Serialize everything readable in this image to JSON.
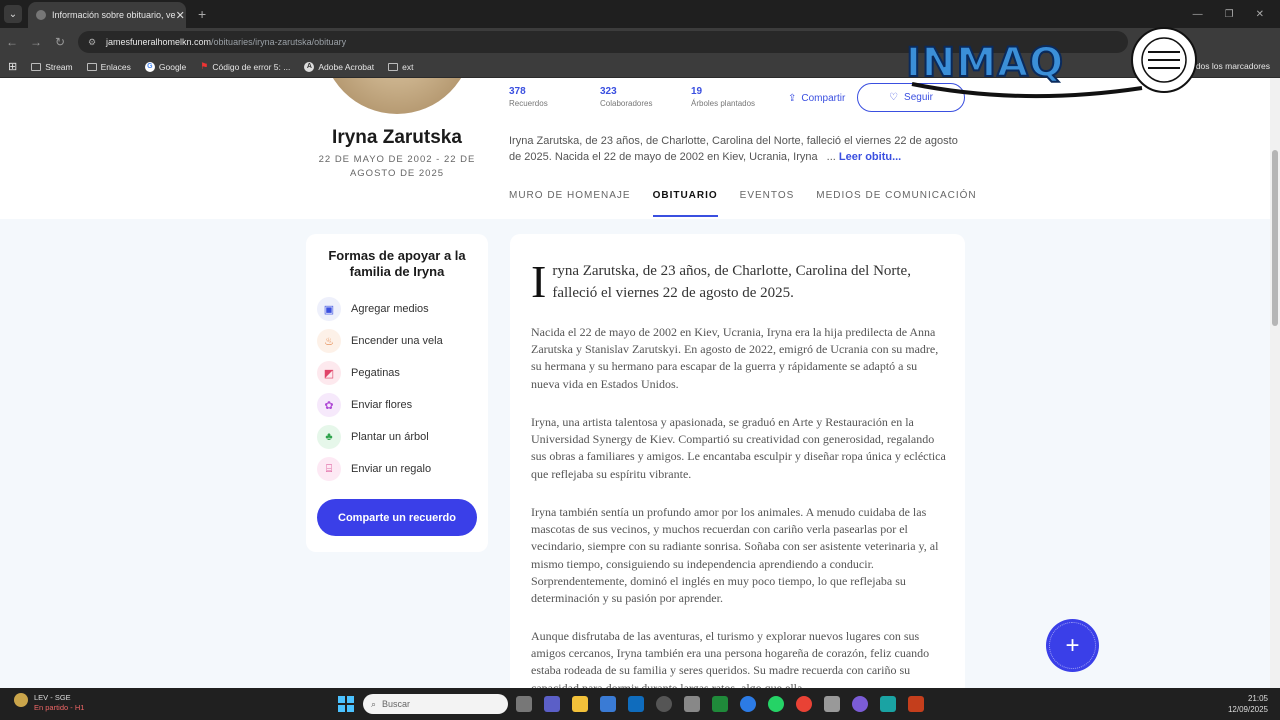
{
  "browser": {
    "tab_title": "Información sobre obituario, ve",
    "tab_close": "✕",
    "new_tab": "+",
    "url_host": "jamesfuneralhomelkn.com",
    "url_path": "/obituaries/iryna-zarutska/obituary",
    "bookmarks": [
      "Stream",
      "Enlaces",
      "Google",
      "Código de error 5: ...",
      "Adobe Acrobat",
      "ext"
    ],
    "bookmarks_right": "dos los marcadores"
  },
  "overlay_logo": "INMAQ",
  "profile": {
    "name": "Iryna Zarutska",
    "dates": "22 DE MAYO DE 2002 - 22 DE AGOSTO DE 2025",
    "stats": [
      {
        "value": "378",
        "label": "Recuerdos"
      },
      {
        "value": "323",
        "label": "Colaboradores"
      },
      {
        "value": "19",
        "label": "Árboles plantados"
      }
    ],
    "share_label": "Compartir",
    "follow_label": "Seguir",
    "intro": "Iryna Zarutska, de 23 años, de Charlotte, Carolina del Norte, falleció el viernes 22 de agosto de 2025. Nacida el 22 de mayo de 2002 en Kiev, Ucrania, Iryna",
    "intro_ellipsis": "...",
    "read_more": "Leer obitu..."
  },
  "tabs": [
    "MURO DE HOMENAJE",
    "OBITUARIO",
    "EVENTOS",
    "MEDIOS DE COMUNICACIÓN"
  ],
  "support": {
    "title": "Formas de apoyar a la familia de Iryna",
    "options": [
      "Agregar medios",
      "Encender una vela",
      "Pegatinas",
      "Enviar flores",
      "Plantar un árbol",
      "Enviar un regalo"
    ],
    "cta": "Comparte un recuerdo"
  },
  "article": {
    "dropcap": "I",
    "lead": "ryna Zarutska, de 23 años, de Charlotte, Carolina del Norte, falleció el viernes 22 de agosto de 2025.",
    "paragraphs": [
      "Nacida el 22 de mayo de 2002 en Kiev, Ucrania, Iryna era la hija predilecta de Anna Zarutska y Stanislav Zarutskyi. En agosto de 2022, emigró de Ucrania con su madre, su hermana y su hermano para escapar de la guerra y rápidamente se adaptó a su nueva vida en Estados Unidos.",
      "Iryna, una artista talentosa y apasionada, se graduó en Arte y Restauración en la Universidad Synergy de Kiev. Compartió su creatividad con generosidad, regalando sus obras a familiares y amigos. Le encantaba esculpir y diseñar ropa única y ecléctica que reflejaba su espíritu vibrante.",
      "Iryna también sentía un profundo amor por los animales. A menudo cuidaba de las mascotas de sus vecinos, y muchos recuerdan con cariño verla pasearlas por el vecindario, siempre con su radiante sonrisa. Soñaba con ser asistente veterinaria y, al mismo tiempo, consiguiendo su independencia aprendiendo a conducir. Sorprendentemente, dominó el inglés en muy poco tiempo, lo que reflejaba su determinación y su pasión por aprender.",
      "Aunque disfrutaba de las aventuras, el turismo y explorar nuevos lugares con sus amigos cercanos, Iryna también era una persona hogareña de corazón, feliz cuando estaba rodeada de su familia y seres queridos. Su madre recuerda con cariño su capacidad para dormir durante largas ratos, algo que ella"
    ]
  },
  "fab": "+",
  "taskbar": {
    "weather_title": "LEV - SGE",
    "weather_sub": "En partido - H1",
    "search": "Buscar",
    "time": "21:05",
    "date": "12/09/2025"
  },
  "colors": {
    "accent": "#3a3fe8",
    "link": "#3a4fe0",
    "page_bg": "#f4f8fc"
  }
}
